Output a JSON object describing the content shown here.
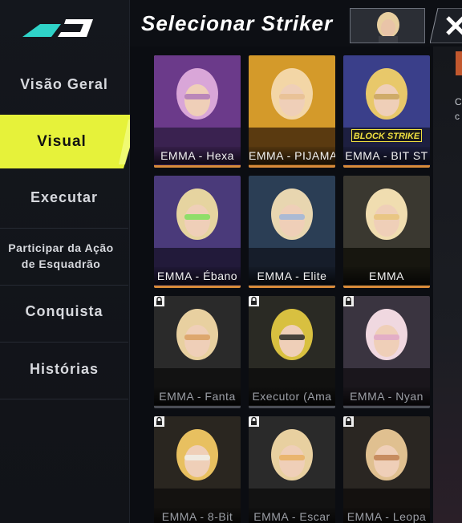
{
  "sidebar": {
    "items": [
      {
        "label": "Visão Geral"
      },
      {
        "label": "Visual",
        "active": true
      },
      {
        "label": "Executar"
      },
      {
        "label": "Participar da Ação de Esquadrão"
      },
      {
        "label": "Conquista"
      },
      {
        "label": "Histórias"
      }
    ]
  },
  "header": {
    "title": "Selecionar Striker",
    "close_icon": "close-x-icon"
  },
  "cards": [
    {
      "label": "EMMA - Hexa",
      "locked": false,
      "selected": true
    },
    {
      "label": "EMMA - PIJAMA",
      "locked": false
    },
    {
      "label": "EMMA - BIT ST",
      "locked": false,
      "badge": "BLOCK STRIKE"
    },
    {
      "label": "EMMA - Ébano",
      "locked": false
    },
    {
      "label": "EMMA - Elite",
      "locked": false
    },
    {
      "label": "EMMA",
      "locked": false
    },
    {
      "label": "EMMA - Fanta",
      "locked": true
    },
    {
      "label": "Executor (Ama",
      "locked": true
    },
    {
      "label": "EMMA - Nyan",
      "locked": true
    },
    {
      "label": "EMMA - 8-Bit",
      "locked": true
    },
    {
      "label": "EMMA - Escar",
      "locked": true
    },
    {
      "label": "EMMA - Leopa",
      "locked": true
    }
  ],
  "right_panel": {
    "text_line1": "C",
    "text_line2": "c"
  },
  "colors": {
    "accent": "#e6f23a",
    "selected_border": "#f3df6a",
    "underline": "#d98b3a"
  }
}
